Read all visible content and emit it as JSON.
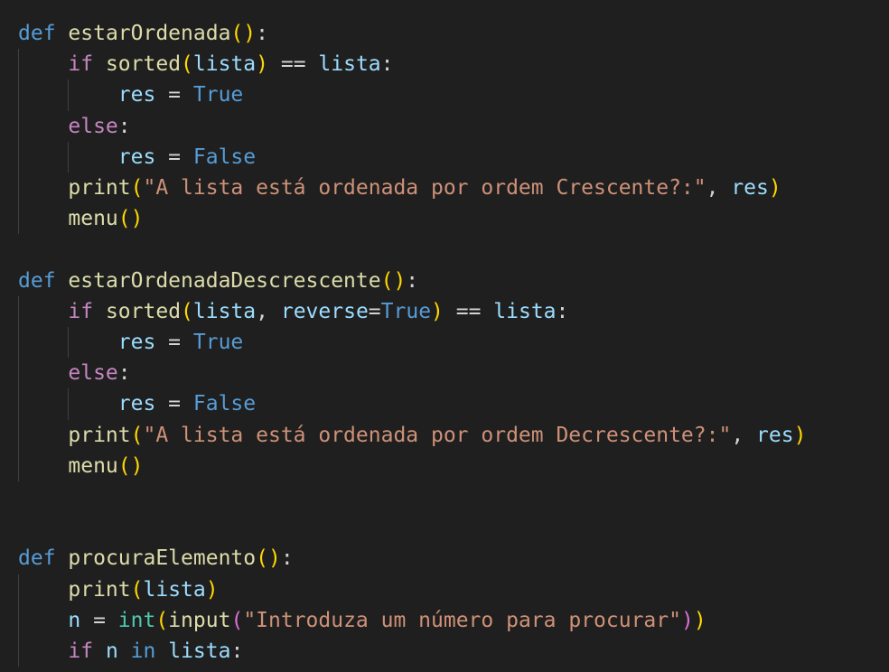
{
  "editor": {
    "theme": "dark",
    "colors": {
      "background": "#1f1f1f",
      "keyword": "#569cd6",
      "control": "#c586c0",
      "function": "#dcdcaa",
      "variable": "#9cdcfe",
      "string": "#ce9178",
      "type": "#4ec9b0",
      "bracket_1": "#ffd700",
      "bracket_2": "#da70d6",
      "bracket_3": "#179fff"
    },
    "lines": [
      {
        "tokens": [
          {
            "t": "def",
            "c": "kw"
          },
          {
            "t": " ",
            "c": "op"
          },
          {
            "t": "estarOrdenada",
            "c": "fn"
          },
          {
            "t": "()",
            "c": "b1"
          },
          {
            "t": ":",
            "c": "op"
          }
        ]
      },
      {
        "tokens": [
          {
            "t": "    ",
            "c": "op"
          },
          {
            "t": "if",
            "c": "ctl"
          },
          {
            "t": " ",
            "c": "op"
          },
          {
            "t": "sorted",
            "c": "fn"
          },
          {
            "t": "(",
            "c": "b1"
          },
          {
            "t": "lista",
            "c": "var"
          },
          {
            "t": ")",
            "c": "b1"
          },
          {
            "t": " == ",
            "c": "op"
          },
          {
            "t": "lista",
            "c": "var"
          },
          {
            "t": ":",
            "c": "op"
          }
        ]
      },
      {
        "tokens": [
          {
            "t": "        ",
            "c": "op"
          },
          {
            "t": "res",
            "c": "var"
          },
          {
            "t": " = ",
            "c": "op"
          },
          {
            "t": "True",
            "c": "kw"
          }
        ]
      },
      {
        "tokens": [
          {
            "t": "    ",
            "c": "op"
          },
          {
            "t": "else",
            "c": "ctl"
          },
          {
            "t": ":",
            "c": "op"
          }
        ]
      },
      {
        "tokens": [
          {
            "t": "        ",
            "c": "op"
          },
          {
            "t": "res",
            "c": "var"
          },
          {
            "t": " = ",
            "c": "op"
          },
          {
            "t": "False",
            "c": "kw"
          }
        ]
      },
      {
        "tokens": [
          {
            "t": "    ",
            "c": "op"
          },
          {
            "t": "print",
            "c": "fn"
          },
          {
            "t": "(",
            "c": "b1"
          },
          {
            "t": "\"A lista está ordenada por ordem Crescente?:\"",
            "c": "str"
          },
          {
            "t": ", ",
            "c": "op"
          },
          {
            "t": "res",
            "c": "var"
          },
          {
            "t": ")",
            "c": "b1"
          }
        ]
      },
      {
        "tokens": [
          {
            "t": "    ",
            "c": "op"
          },
          {
            "t": "menu",
            "c": "fn"
          },
          {
            "t": "()",
            "c": "b1"
          }
        ]
      },
      {
        "tokens": []
      },
      {
        "tokens": [
          {
            "t": "def",
            "c": "kw"
          },
          {
            "t": " ",
            "c": "op"
          },
          {
            "t": "estarOrdenadaDescrescente",
            "c": "fn"
          },
          {
            "t": "()",
            "c": "b1"
          },
          {
            "t": ":",
            "c": "op"
          }
        ]
      },
      {
        "tokens": [
          {
            "t": "    ",
            "c": "op"
          },
          {
            "t": "if",
            "c": "ctl"
          },
          {
            "t": " ",
            "c": "op"
          },
          {
            "t": "sorted",
            "c": "fn"
          },
          {
            "t": "(",
            "c": "b1"
          },
          {
            "t": "lista",
            "c": "var"
          },
          {
            "t": ", ",
            "c": "op"
          },
          {
            "t": "reverse",
            "c": "var"
          },
          {
            "t": "=",
            "c": "op"
          },
          {
            "t": "True",
            "c": "kw"
          },
          {
            "t": ")",
            "c": "b1"
          },
          {
            "t": " == ",
            "c": "op"
          },
          {
            "t": "lista",
            "c": "var"
          },
          {
            "t": ":",
            "c": "op"
          }
        ]
      },
      {
        "tokens": [
          {
            "t": "        ",
            "c": "op"
          },
          {
            "t": "res",
            "c": "var"
          },
          {
            "t": " = ",
            "c": "op"
          },
          {
            "t": "True",
            "c": "kw"
          }
        ]
      },
      {
        "tokens": [
          {
            "t": "    ",
            "c": "op"
          },
          {
            "t": "else",
            "c": "ctl"
          },
          {
            "t": ":",
            "c": "op"
          }
        ]
      },
      {
        "tokens": [
          {
            "t": "        ",
            "c": "op"
          },
          {
            "t": "res",
            "c": "var"
          },
          {
            "t": " = ",
            "c": "op"
          },
          {
            "t": "False",
            "c": "kw"
          }
        ]
      },
      {
        "tokens": [
          {
            "t": "    ",
            "c": "op"
          },
          {
            "t": "print",
            "c": "fn"
          },
          {
            "t": "(",
            "c": "b1"
          },
          {
            "t": "\"A lista está ordenada por ordem Decrescente?:\"",
            "c": "str"
          },
          {
            "t": ", ",
            "c": "op"
          },
          {
            "t": "res",
            "c": "var"
          },
          {
            "t": ")",
            "c": "b1"
          }
        ]
      },
      {
        "tokens": [
          {
            "t": "    ",
            "c": "op"
          },
          {
            "t": "menu",
            "c": "fn"
          },
          {
            "t": "()",
            "c": "b1"
          }
        ]
      },
      {
        "tokens": []
      },
      {
        "tokens": []
      },
      {
        "tokens": [
          {
            "t": "def",
            "c": "kw"
          },
          {
            "t": " ",
            "c": "op"
          },
          {
            "t": "procuraElemento",
            "c": "fn"
          },
          {
            "t": "()",
            "c": "b1"
          },
          {
            "t": ":",
            "c": "op"
          }
        ]
      },
      {
        "tokens": [
          {
            "t": "    ",
            "c": "op"
          },
          {
            "t": "print",
            "c": "fn"
          },
          {
            "t": "(",
            "c": "b1"
          },
          {
            "t": "lista",
            "c": "var"
          },
          {
            "t": ")",
            "c": "b1"
          }
        ]
      },
      {
        "tokens": [
          {
            "t": "    ",
            "c": "op"
          },
          {
            "t": "n",
            "c": "var"
          },
          {
            "t": " = ",
            "c": "op"
          },
          {
            "t": "int",
            "c": "typ"
          },
          {
            "t": "(",
            "c": "b1"
          },
          {
            "t": "input",
            "c": "fn"
          },
          {
            "t": "(",
            "c": "b2"
          },
          {
            "t": "\"Introduza um número para procurar\"",
            "c": "str"
          },
          {
            "t": ")",
            "c": "b2"
          },
          {
            "t": ")",
            "c": "b1"
          }
        ]
      },
      {
        "tokens": [
          {
            "t": "    ",
            "c": "op"
          },
          {
            "t": "if",
            "c": "ctl"
          },
          {
            "t": " ",
            "c": "op"
          },
          {
            "t": "n",
            "c": "var"
          },
          {
            "t": " ",
            "c": "op"
          },
          {
            "t": "in",
            "c": "kw"
          },
          {
            "t": " ",
            "c": "op"
          },
          {
            "t": "lista",
            "c": "var"
          },
          {
            "t": ":",
            "c": "op"
          }
        ]
      }
    ]
  }
}
